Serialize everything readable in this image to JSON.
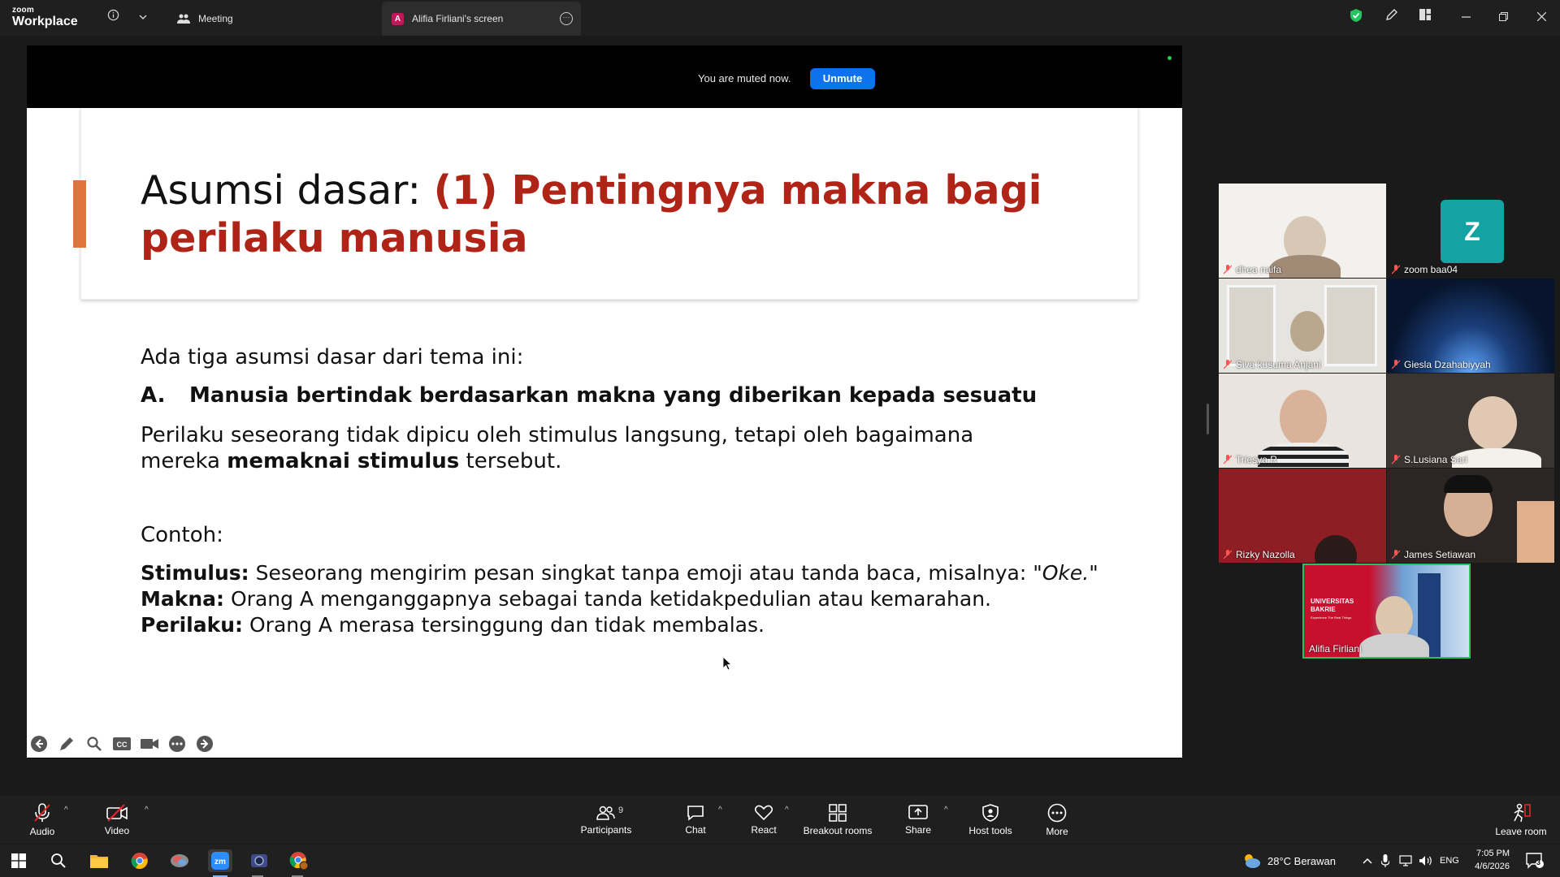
{
  "app": {
    "logo_line1": "zoom",
    "logo_line2": "Workplace"
  },
  "tabs": {
    "meeting": "Meeting",
    "screen": "Alifia Firliani's screen",
    "screen_badge": "A"
  },
  "muted": {
    "text": "You are muted now.",
    "button": "Unmute"
  },
  "slide": {
    "title_prefix": "Asumsi dasar: ",
    "title_highlight": "(1) Pentingnya makna bagi perilaku manusia",
    "intro": "Ada tiga asumsi dasar dari tema ini:",
    "point_letter": "A.",
    "point_text": "Manusia bertindak berdasarkan makna yang diberikan kepada sesuatu",
    "desc_1": "Perilaku seseorang tidak dipicu oleh stimulus langsung, tetapi oleh bagaimana",
    "desc_2_pre": "mereka ",
    "desc_2_bold": "memaknai stimulus",
    "desc_2_post": " tersebut.",
    "contoh": "Contoh:",
    "ex1_label": "Stimulus:",
    "ex1_text": " Seseorang mengirim pesan singkat tanpa emoji atau tanda baca, misalnya: ",
    "ex1_quote": "\"Oke.\"",
    "ex2_label": "Makna:",
    "ex2_text": " Orang A menganggapnya sebagai tanda ketidakpedulian atau kemarahan.",
    "ex3_label": "Perilaku:",
    "ex3_text": " Orang A merasa tersinggung dan tidak membalas."
  },
  "participants": [
    {
      "name": "dhea naifa"
    },
    {
      "name": "zoom baa04",
      "initial": "Z"
    },
    {
      "name": "Siva kusuma Anjani"
    },
    {
      "name": "Giesla Dzahabiyyah"
    },
    {
      "name": "Triesya R"
    },
    {
      "name": "S.Lusiana Sari"
    },
    {
      "name": "Rizky Nazolla"
    },
    {
      "name": "James Setiawan"
    },
    {
      "name": "Alifia Firliani",
      "banner_line1": "UNIVERSITAS",
      "banner_line2": "BAKRIE",
      "banner_line3": "Experience The Real Things"
    }
  ],
  "controls": {
    "audio": "Audio",
    "video": "Video",
    "participants": "Participants",
    "participants_count": "9",
    "chat": "Chat",
    "react": "React",
    "breakout": "Breakout rooms",
    "share": "Share",
    "host_tools": "Host tools",
    "more": "More",
    "leave": "Leave room"
  },
  "taskbar": {
    "weather": "28°C Berawan",
    "lang": "ENG",
    "time": "7:05 PM",
    "date": "4/6/2026",
    "notif_count": "3"
  },
  "colors": {
    "accent_blue": "#0e72ed",
    "title_red": "#b02418",
    "accent_orange": "#e0743c",
    "avatar_teal": "#14a3a3"
  }
}
